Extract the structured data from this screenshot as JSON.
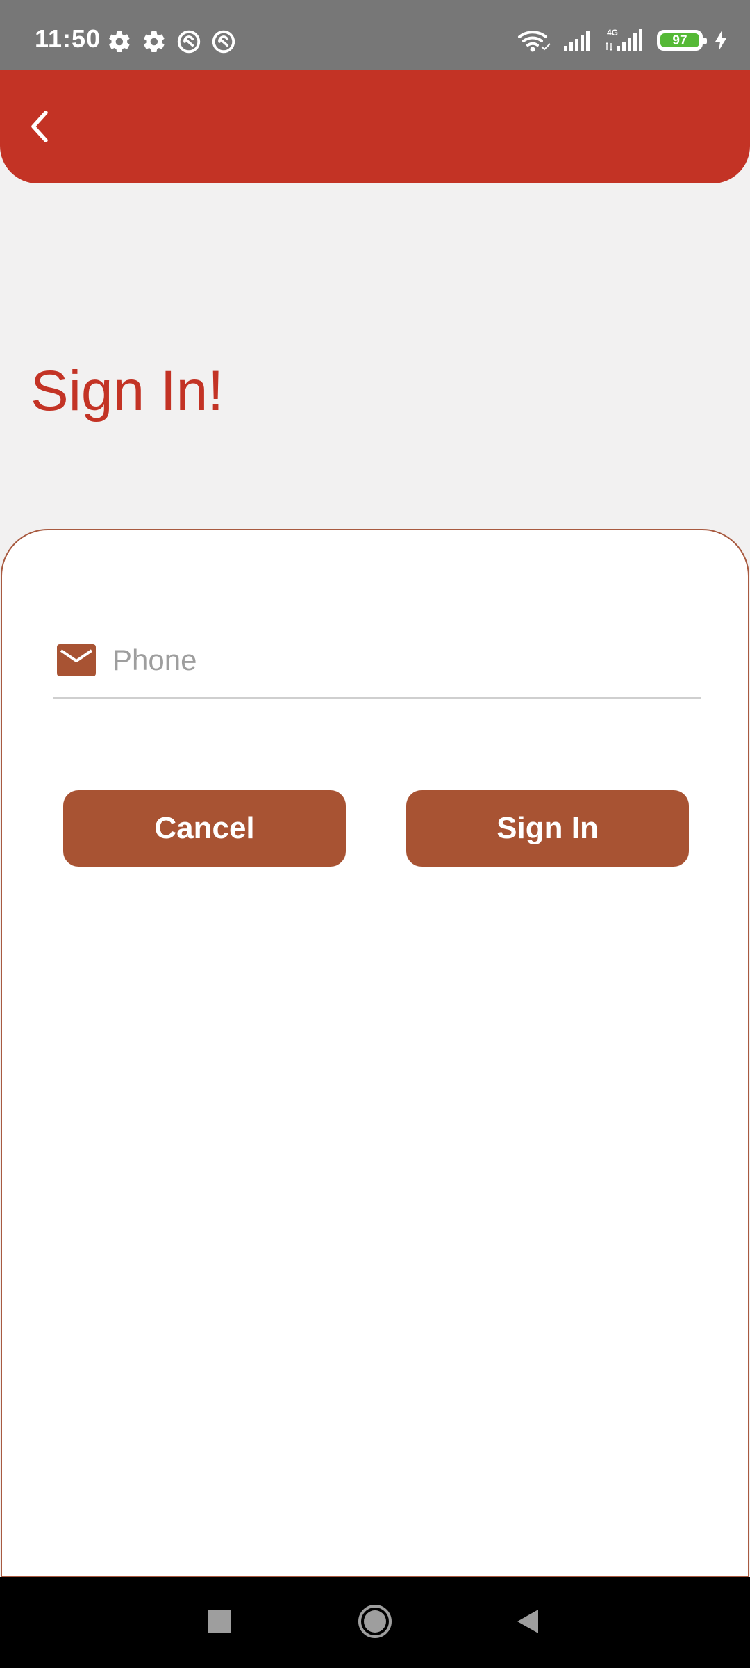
{
  "status_bar": {
    "time": "11:50",
    "left_icons": [
      "gear-icon",
      "gear-icon",
      "sync-icon",
      "sync-icon"
    ],
    "right_icons": [
      "wifi-icon",
      "signal-icon",
      "signal-4g-icon"
    ],
    "network_label": "4G",
    "battery_level": "97",
    "charging": true
  },
  "app_bar": {
    "back_icon": "chevron-left-icon",
    "color": "#c33325"
  },
  "page": {
    "title": "Sign In!"
  },
  "form": {
    "phone": {
      "icon": "mail-icon",
      "placeholder": "Phone",
      "value": ""
    },
    "cancel_label": "Cancel",
    "signin_label": "Sign In",
    "button_color": "#a85333"
  },
  "nav_bar": {
    "recents_icon": "square-icon",
    "home_icon": "circle-icon",
    "back_icon": "triangle-back-icon"
  },
  "colors": {
    "brand_red": "#c33325",
    "accent_brown": "#a85333",
    "background": "#f2f1f1",
    "status_bar": "#777777",
    "battery_green": "#55b936"
  }
}
